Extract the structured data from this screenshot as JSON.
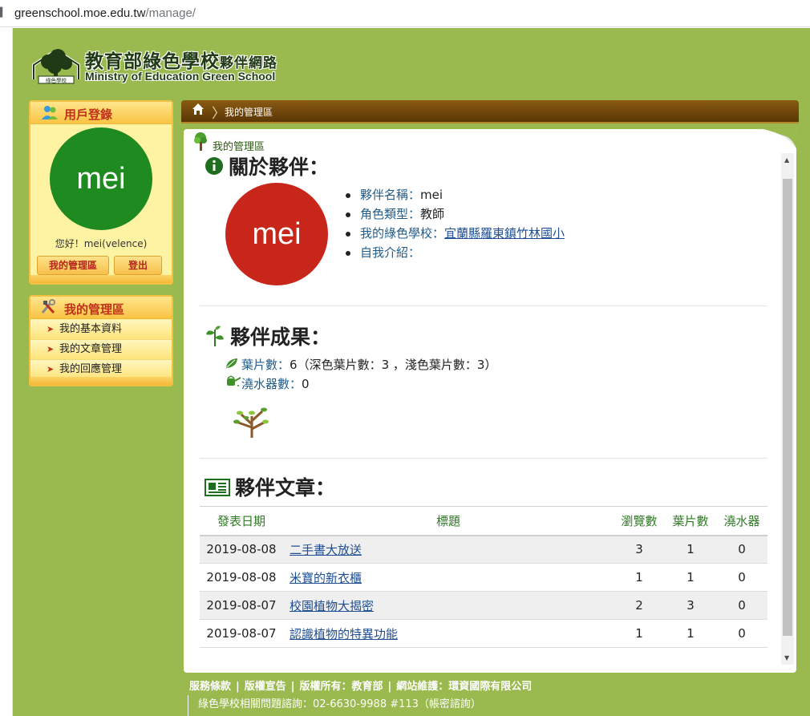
{
  "browser": {
    "url_host": "greenschool.moe.edu.tw",
    "url_path": "/manage/"
  },
  "logo": {
    "zh_main": "教育部綠色學校",
    "zh_small": "夥伴網路",
    "en": "Ministry of Education Green School",
    "badge": "綠色學校"
  },
  "login_box": {
    "title": "用戶登錄",
    "avatar_text": "mei",
    "greeting": "您好！mei(velence)",
    "manage_btn": "我的管理區",
    "logout_btn": "登出"
  },
  "manage_box": {
    "title": "我的管理區",
    "items": [
      "我的基本資料",
      "我的文章管理",
      "我的回應管理"
    ]
  },
  "breadcrumb": {
    "current": "我的管理區"
  },
  "panel": {
    "title": "我的管理區",
    "about": {
      "heading": "關於夥伴：",
      "avatar_text": "mei",
      "name_label": "夥伴名稱：",
      "name_value": "mei",
      "role_label": "角色類型：",
      "role_value": "教師",
      "school_label": "我的綠色學校：",
      "school_value": "宜蘭縣羅東鎮竹林國小",
      "intro_label": "自我介紹：",
      "intro_value": ""
    },
    "achievements": {
      "heading": "夥伴成果：",
      "leaves_label": "葉片數：",
      "leaves_value": "6",
      "leaves_detail": "（深色葉片數：3 ，淺色葉片數：3）",
      "water_label": "澆水器數：",
      "water_value": "0"
    },
    "articles": {
      "heading": "夥伴文章：",
      "columns": [
        "發表日期",
        "標題",
        "瀏覽數",
        "葉片數",
        "澆水器"
      ],
      "rows": [
        {
          "date": "2019-08-08",
          "title": "二手書大放送",
          "views": "3",
          "leaves": "1",
          "water": "0"
        },
        {
          "date": "2019-08-08",
          "title": "米寶的新衣櫃",
          "views": "1",
          "leaves": "1",
          "water": "0"
        },
        {
          "date": "2019-08-07",
          "title": "校園植物大揭密",
          "views": "2",
          "leaves": "3",
          "water": "0"
        },
        {
          "date": "2019-08-07",
          "title": "認識植物的特異功能",
          "views": "1",
          "leaves": "1",
          "water": "0"
        }
      ]
    }
  },
  "footer": {
    "links": [
      "服務條款",
      "版權宣告",
      "版權所有：教育部",
      "網站維護：環資國際有限公司"
    ],
    "separator": "|",
    "contact": "綠色學校相關問題諮詢：02-6630-9988 #113（帳密諮詢）"
  },
  "colors": {
    "page_bg": "#9ab94e",
    "avatar_small": "#1f8a1f",
    "avatar_large": "#c8261a",
    "accent_red": "#c0311b",
    "link_blue": "#1f4e94"
  }
}
